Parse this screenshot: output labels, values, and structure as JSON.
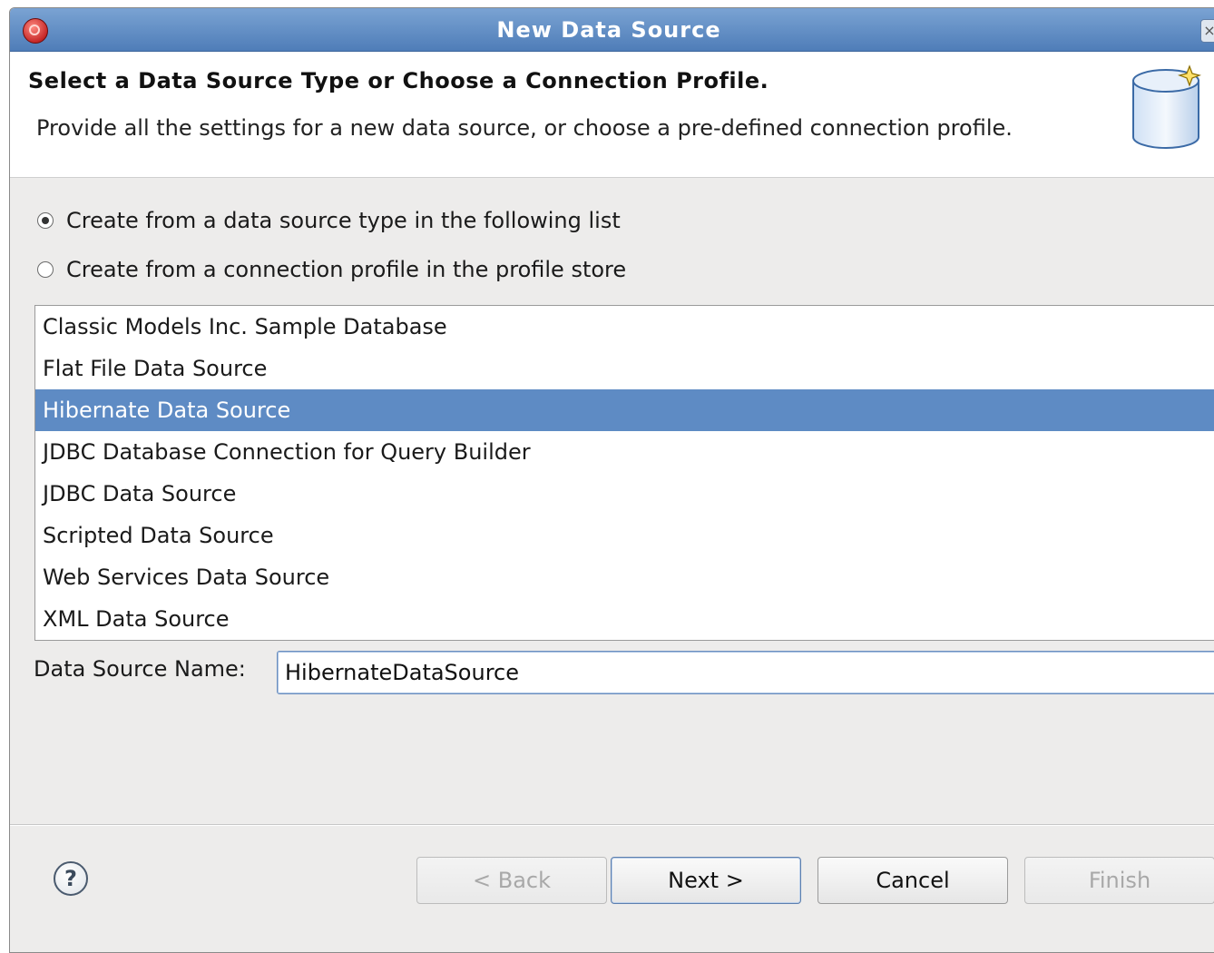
{
  "window": {
    "title": "New Data Source"
  },
  "banner": {
    "heading": "Select a Data Source Type or Choose a Connection Profile.",
    "description": "Provide all the settings for a new data source, or choose a pre-defined connection profile."
  },
  "options": {
    "from_type": {
      "label": "Create from a data source type in the following list",
      "checked": true
    },
    "from_profile": {
      "label": "Create from a connection profile in the profile store",
      "checked": false
    }
  },
  "data_source_types": {
    "items": [
      {
        "label": "Classic Models Inc. Sample Database",
        "selected": false
      },
      {
        "label": "Flat File Data Source",
        "selected": false
      },
      {
        "label": "Hibernate Data Source",
        "selected": true
      },
      {
        "label": "JDBC Database Connection for Query Builder",
        "selected": false
      },
      {
        "label": "JDBC Data Source",
        "selected": false
      },
      {
        "label": "Scripted Data Source",
        "selected": false
      },
      {
        "label": "Web Services Data Source",
        "selected": false
      },
      {
        "label": "XML Data Source",
        "selected": false
      }
    ]
  },
  "name_field": {
    "label": "Data Source Name:",
    "value": "HibernateDataSource"
  },
  "buttons": {
    "back": {
      "label": "< Back",
      "enabled": false
    },
    "next": {
      "label": "Next >",
      "enabled": true
    },
    "cancel": {
      "label": "Cancel",
      "enabled": true
    },
    "finish": {
      "label": "Finish",
      "enabled": false
    }
  },
  "icons": {
    "app": "birt-app-icon",
    "banner": "database-wizard-icon",
    "help": "help-icon",
    "selection_color": "#5e8bc4"
  }
}
